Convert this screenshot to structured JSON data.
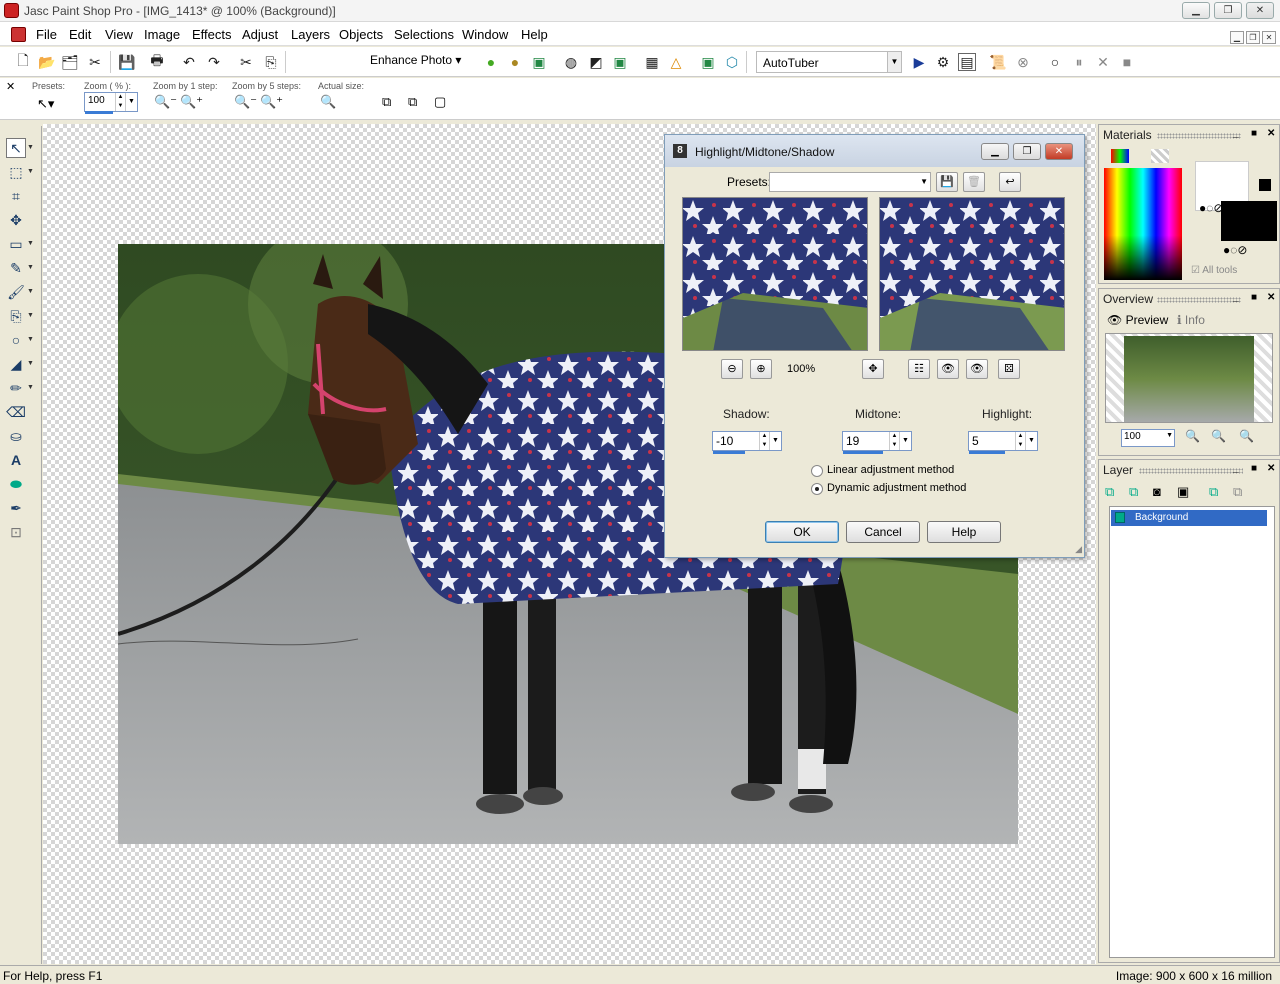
{
  "window": {
    "title": "Jasc Paint Shop Pro - [IMG_1413* @ 100% (Background)]",
    "minimize_icon": "minimize-icon",
    "maximize_icon": "restore-icon",
    "close_icon": "close-icon"
  },
  "menubar": {
    "items": [
      "File",
      "Edit",
      "View",
      "Image",
      "Effects",
      "Adjust",
      "Layers",
      "Objects",
      "Selections",
      "Window",
      "Help"
    ]
  },
  "toolbar": {
    "enhance_photo_label": "Enhance Photo",
    "script_select_value": "AutoTuber"
  },
  "tool_options": {
    "presets_label": "Presets:",
    "zoom_label": "Zoom ( % ):",
    "zoom_value": "100",
    "zoom_by_1_label": "Zoom by 1 step:",
    "zoom_by_5_label": "Zoom by 5 steps:",
    "actual_size_label": "Actual size:"
  },
  "dialog": {
    "title": "Highlight/Midtone/Shadow",
    "presets_label": "Presets:",
    "presets_value": "",
    "zoom_value": "100%",
    "shadow_label": "Shadow:",
    "shadow_value": "-10",
    "midtone_label": "Midtone:",
    "midtone_value": "19",
    "highlight_label": "Highlight:",
    "highlight_value": "5",
    "method_linear_label": "Linear adjustment method",
    "method_dynamic_label": "Dynamic adjustment method",
    "method_selected": "dynamic",
    "ok_label": "OK",
    "cancel_label": "Cancel",
    "help_label": "Help"
  },
  "materials": {
    "title": "Materials",
    "all_tools_label": "All tools"
  },
  "overview": {
    "title": "Overview",
    "tab_preview": "Preview",
    "tab_info": "Info",
    "zoom_value": "100"
  },
  "layers": {
    "title": "Layer",
    "rows": [
      "Background"
    ]
  },
  "statusbar": {
    "help_text": "For Help, press F1",
    "image_info": "Image:  900 x 600 x 16 million"
  }
}
